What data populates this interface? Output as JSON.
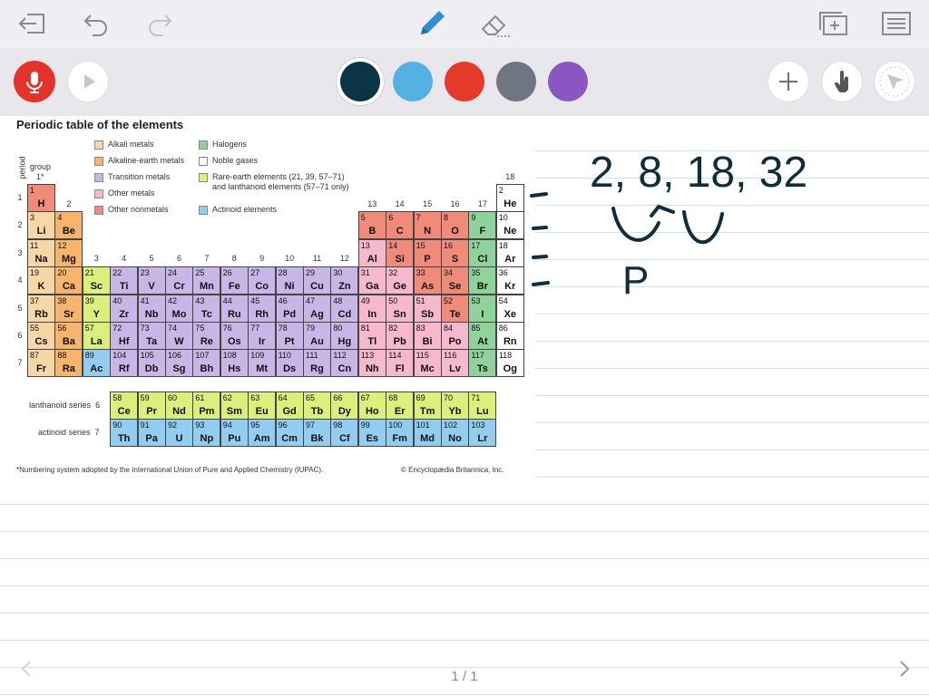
{
  "colors": {
    "alkali": "#f7d7a8",
    "alkaline": "#f6b46d",
    "transition": "#c9b6e6",
    "other_metal": "#f5b8cc",
    "nonmetal": "#ef8b78",
    "halogen": "#8fd29c",
    "noble": "#ffffff",
    "rare_earth": "#dcee7b",
    "actinoid": "#92cdef",
    "pen_blue": "#2e8fd4",
    "ink": "#0f2e3d"
  },
  "toolbar": {
    "swatches": [
      "#0b3446",
      "#56b1e3",
      "#e43a2c",
      "#6e7781",
      "#8b56c2"
    ],
    "selected_swatch": 0
  },
  "document": {
    "title": "Periodic table of the elements",
    "period_axis": "period",
    "group_axis": "group",
    "group_one": "1*",
    "legend": [
      {
        "label": "Alkali metals",
        "cat": "alkali"
      },
      {
        "label": "Alkaline-earth metals",
        "cat": "alkaline"
      },
      {
        "label": "Transition metals",
        "cat": "transition"
      },
      {
        "label": "Other metals",
        "cat": "other_metal"
      },
      {
        "label": "Other nonmetals",
        "cat": "nonmetal"
      },
      {
        "label": "Halogens",
        "cat": "halogen"
      },
      {
        "label": "Noble gases",
        "cat": "noble"
      },
      {
        "label": "Rare-earth elements (21, 39, 57–71)\nand lanthanoid elements (57–71 only)",
        "cat": "rare_earth"
      },
      {
        "label": "Actinoid elements",
        "cat": "actinoid"
      }
    ],
    "lanthanoid_label": "lanthanoid series",
    "lanthanoid_period": "6",
    "actinoid_label": "actinoid series",
    "actinoid_period": "7",
    "footnote": "*Numbering system adopted by the International Union of Pure and Applied Chemistry (IUPAC).",
    "copyright": "© Encyclopædia Britannica, Inc.",
    "group_numbers": [
      "2",
      "3",
      "4",
      "5",
      "6",
      "7",
      "8",
      "9",
      "10",
      "11",
      "12",
      "13",
      "14",
      "15",
      "16",
      "17",
      "18"
    ],
    "period_numbers": [
      "1",
      "2",
      "3",
      "4",
      "5",
      "6",
      "7"
    ],
    "elements": [
      {
        "n": "1",
        "s": "H",
        "g": 1,
        "p": 1,
        "c": "nonmetal"
      },
      {
        "n": "2",
        "s": "He",
        "g": 18,
        "p": 1,
        "c": "noble"
      },
      {
        "n": "3",
        "s": "Li",
        "g": 1,
        "p": 2,
        "c": "alkali"
      },
      {
        "n": "4",
        "s": "Be",
        "g": 2,
        "p": 2,
        "c": "alkaline"
      },
      {
        "n": "5",
        "s": "B",
        "g": 13,
        "p": 2,
        "c": "nonmetal"
      },
      {
        "n": "6",
        "s": "C",
        "g": 14,
        "p": 2,
        "c": "nonmetal"
      },
      {
        "n": "7",
        "s": "N",
        "g": 15,
        "p": 2,
        "c": "nonmetal"
      },
      {
        "n": "8",
        "s": "O",
        "g": 16,
        "p": 2,
        "c": "nonmetal"
      },
      {
        "n": "9",
        "s": "F",
        "g": 17,
        "p": 2,
        "c": "halogen"
      },
      {
        "n": "10",
        "s": "Ne",
        "g": 18,
        "p": 2,
        "c": "noble"
      },
      {
        "n": "11",
        "s": "Na",
        "g": 1,
        "p": 3,
        "c": "alkali"
      },
      {
        "n": "12",
        "s": "Mg",
        "g": 2,
        "p": 3,
        "c": "alkaline"
      },
      {
        "n": "13",
        "s": "Al",
        "g": 13,
        "p": 3,
        "c": "other_metal"
      },
      {
        "n": "14",
        "s": "Si",
        "g": 14,
        "p": 3,
        "c": "nonmetal"
      },
      {
        "n": "15",
        "s": "P",
        "g": 15,
        "p": 3,
        "c": "nonmetal"
      },
      {
        "n": "16",
        "s": "S",
        "g": 16,
        "p": 3,
        "c": "nonmetal"
      },
      {
        "n": "17",
        "s": "Cl",
        "g": 17,
        "p": 3,
        "c": "halogen"
      },
      {
        "n": "18",
        "s": "Ar",
        "g": 18,
        "p": 3,
        "c": "noble"
      },
      {
        "n": "19",
        "s": "K",
        "g": 1,
        "p": 4,
        "c": "alkali"
      },
      {
        "n": "20",
        "s": "Ca",
        "g": 2,
        "p": 4,
        "c": "alkaline"
      },
      {
        "n": "21",
        "s": "Sc",
        "g": 3,
        "p": 4,
        "c": "rare_earth"
      },
      {
        "n": "22",
        "s": "Ti",
        "g": 4,
        "p": 4,
        "c": "transition"
      },
      {
        "n": "23",
        "s": "V",
        "g": 5,
        "p": 4,
        "c": "transition"
      },
      {
        "n": "24",
        "s": "Cr",
        "g": 6,
        "p": 4,
        "c": "transition"
      },
      {
        "n": "25",
        "s": "Mn",
        "g": 7,
        "p": 4,
        "c": "transition"
      },
      {
        "n": "26",
        "s": "Fe",
        "g": 8,
        "p": 4,
        "c": "transition"
      },
      {
        "n": "27",
        "s": "Co",
        "g": 9,
        "p": 4,
        "c": "transition"
      },
      {
        "n": "28",
        "s": "Ni",
        "g": 10,
        "p": 4,
        "c": "transition"
      },
      {
        "n": "29",
        "s": "Cu",
        "g": 11,
        "p": 4,
        "c": "transition"
      },
      {
        "n": "30",
        "s": "Zn",
        "g": 12,
        "p": 4,
        "c": "transition"
      },
      {
        "n": "31",
        "s": "Ga",
        "g": 13,
        "p": 4,
        "c": "other_metal"
      },
      {
        "n": "32",
        "s": "Ge",
        "g": 14,
        "p": 4,
        "c": "other_metal"
      },
      {
        "n": "33",
        "s": "As",
        "g": 15,
        "p": 4,
        "c": "nonmetal"
      },
      {
        "n": "34",
        "s": "Se",
        "g": 16,
        "p": 4,
        "c": "nonmetal"
      },
      {
        "n": "35",
        "s": "Br",
        "g": 17,
        "p": 4,
        "c": "halogen"
      },
      {
        "n": "36",
        "s": "Kr",
        "g": 18,
        "p": 4,
        "c": "noble"
      },
      {
        "n": "37",
        "s": "Rb",
        "g": 1,
        "p": 5,
        "c": "alkali"
      },
      {
        "n": "38",
        "s": "Sr",
        "g": 2,
        "p": 5,
        "c": "alkaline"
      },
      {
        "n": "39",
        "s": "Y",
        "g": 3,
        "p": 5,
        "c": "rare_earth"
      },
      {
        "n": "40",
        "s": "Zr",
        "g": 4,
        "p": 5,
        "c": "transition"
      },
      {
        "n": "41",
        "s": "Nb",
        "g": 5,
        "p": 5,
        "c": "transition"
      },
      {
        "n": "42",
        "s": "Mo",
        "g": 6,
        "p": 5,
        "c": "transition"
      },
      {
        "n": "43",
        "s": "Tc",
        "g": 7,
        "p": 5,
        "c": "transition"
      },
      {
        "n": "44",
        "s": "Ru",
        "g": 8,
        "p": 5,
        "c": "transition"
      },
      {
        "n": "45",
        "s": "Rh",
        "g": 9,
        "p": 5,
        "c": "transition"
      },
      {
        "n": "46",
        "s": "Pd",
        "g": 10,
        "p": 5,
        "c": "transition"
      },
      {
        "n": "47",
        "s": "Ag",
        "g": 11,
        "p": 5,
        "c": "transition"
      },
      {
        "n": "48",
        "s": "Cd",
        "g": 12,
        "p": 5,
        "c": "transition"
      },
      {
        "n": "49",
        "s": "In",
        "g": 13,
        "p": 5,
        "c": "other_metal"
      },
      {
        "n": "50",
        "s": "Sn",
        "g": 14,
        "p": 5,
        "c": "other_metal"
      },
      {
        "n": "51",
        "s": "Sb",
        "g": 15,
        "p": 5,
        "c": "other_metal"
      },
      {
        "n": "52",
        "s": "Te",
        "g": 16,
        "p": 5,
        "c": "nonmetal"
      },
      {
        "n": "53",
        "s": "I",
        "g": 17,
        "p": 5,
        "c": "halogen"
      },
      {
        "n": "54",
        "s": "Xe",
        "g": 18,
        "p": 5,
        "c": "noble"
      },
      {
        "n": "55",
        "s": "Cs",
        "g": 1,
        "p": 6,
        "c": "alkali"
      },
      {
        "n": "56",
        "s": "Ba",
        "g": 2,
        "p": 6,
        "c": "alkaline"
      },
      {
        "n": "57",
        "s": "La",
        "g": 3,
        "p": 6,
        "c": "rare_earth"
      },
      {
        "n": "72",
        "s": "Hf",
        "g": 4,
        "p": 6,
        "c": "transition"
      },
      {
        "n": "73",
        "s": "Ta",
        "g": 5,
        "p": 6,
        "c": "transition"
      },
      {
        "n": "74",
        "s": "W",
        "g": 6,
        "p": 6,
        "c": "transition"
      },
      {
        "n": "75",
        "s": "Re",
        "g": 7,
        "p": 6,
        "c": "transition"
      },
      {
        "n": "76",
        "s": "Os",
        "g": 8,
        "p": 6,
        "c": "transition"
      },
      {
        "n": "77",
        "s": "Ir",
        "g": 9,
        "p": 6,
        "c": "transition"
      },
      {
        "n": "78",
        "s": "Pt",
        "g": 10,
        "p": 6,
        "c": "transition"
      },
      {
        "n": "79",
        "s": "Au",
        "g": 11,
        "p": 6,
        "c": "transition"
      },
      {
        "n": "80",
        "s": "Hg",
        "g": 12,
        "p": 6,
        "c": "transition"
      },
      {
        "n": "81",
        "s": "Tl",
        "g": 13,
        "p": 6,
        "c": "other_metal"
      },
      {
        "n": "82",
        "s": "Pb",
        "g": 14,
        "p": 6,
        "c": "other_metal"
      },
      {
        "n": "83",
        "s": "Bi",
        "g": 15,
        "p": 6,
        "c": "other_metal"
      },
      {
        "n": "84",
        "s": "Po",
        "g": 16,
        "p": 6,
        "c": "other_metal"
      },
      {
        "n": "85",
        "s": "At",
        "g": 17,
        "p": 6,
        "c": "halogen"
      },
      {
        "n": "86",
        "s": "Rn",
        "g": 18,
        "p": 6,
        "c": "noble"
      },
      {
        "n": "87",
        "s": "Fr",
        "g": 1,
        "p": 7,
        "c": "alkali"
      },
      {
        "n": "88",
        "s": "Ra",
        "g": 2,
        "p": 7,
        "c": "alkaline"
      },
      {
        "n": "89",
        "s": "Ac",
        "g": 3,
        "p": 7,
        "c": "actinoid"
      },
      {
        "n": "104",
        "s": "Rf",
        "g": 4,
        "p": 7,
        "c": "transition"
      },
      {
        "n": "105",
        "s": "Db",
        "g": 5,
        "p": 7,
        "c": "transition"
      },
      {
        "n": "106",
        "s": "Sg",
        "g": 6,
        "p": 7,
        "c": "transition"
      },
      {
        "n": "107",
        "s": "Bh",
        "g": 7,
        "p": 7,
        "c": "transition"
      },
      {
        "n": "108",
        "s": "Hs",
        "g": 8,
        "p": 7,
        "c": "transition"
      },
      {
        "n": "109",
        "s": "Mt",
        "g": 9,
        "p": 7,
        "c": "transition"
      },
      {
        "n": "110",
        "s": "Ds",
        "g": 10,
        "p": 7,
        "c": "transition"
      },
      {
        "n": "111",
        "s": "Rg",
        "g": 11,
        "p": 7,
        "c": "transition"
      },
      {
        "n": "112",
        "s": "Cn",
        "g": 12,
        "p": 7,
        "c": "transition"
      },
      {
        "n": "113",
        "s": "Nh",
        "g": 13,
        "p": 7,
        "c": "other_metal"
      },
      {
        "n": "114",
        "s": "Fl",
        "g": 14,
        "p": 7,
        "c": "other_metal"
      },
      {
        "n": "115",
        "s": "Mc",
        "g": 15,
        "p": 7,
        "c": "other_metal"
      },
      {
        "n": "116",
        "s": "Lv",
        "g": 16,
        "p": 7,
        "c": "other_metal"
      },
      {
        "n": "117",
        "s": "Ts",
        "g": 17,
        "p": 7,
        "c": "halogen"
      },
      {
        "n": "118",
        "s": "Og",
        "g": 18,
        "p": 7,
        "c": "noble"
      }
    ],
    "lanthanoids": [
      {
        "n": "58",
        "s": "Ce"
      },
      {
        "n": "59",
        "s": "Pr"
      },
      {
        "n": "60",
        "s": "Nd"
      },
      {
        "n": "61",
        "s": "Pm"
      },
      {
        "n": "62",
        "s": "Sm"
      },
      {
        "n": "63",
        "s": "Eu"
      },
      {
        "n": "64",
        "s": "Gd"
      },
      {
        "n": "65",
        "s": "Tb"
      },
      {
        "n": "66",
        "s": "Dy"
      },
      {
        "n": "67",
        "s": "Ho"
      },
      {
        "n": "68",
        "s": "Er"
      },
      {
        "n": "69",
        "s": "Tm"
      },
      {
        "n": "70",
        "s": "Yb"
      },
      {
        "n": "71",
        "s": "Lu"
      }
    ],
    "actinoids": [
      {
        "n": "90",
        "s": "Th"
      },
      {
        "n": "91",
        "s": "Pa"
      },
      {
        "n": "92",
        "s": "U"
      },
      {
        "n": "93",
        "s": "Np"
      },
      {
        "n": "94",
        "s": "Pu"
      },
      {
        "n": "95",
        "s": "Am"
      },
      {
        "n": "96",
        "s": "Cm"
      },
      {
        "n": "97",
        "s": "Bk"
      },
      {
        "n": "98",
        "s": "Cf"
      },
      {
        "n": "99",
        "s": "Es"
      },
      {
        "n": "100",
        "s": "Fm"
      },
      {
        "n": "101",
        "s": "Md"
      },
      {
        "n": "102",
        "s": "No"
      },
      {
        "n": "103",
        "s": "Lr"
      }
    ]
  },
  "annotation": {
    "numbers_text": "2, 8, 18, 32",
    "letter": "P"
  },
  "pagination": {
    "label": "1 / 1"
  }
}
